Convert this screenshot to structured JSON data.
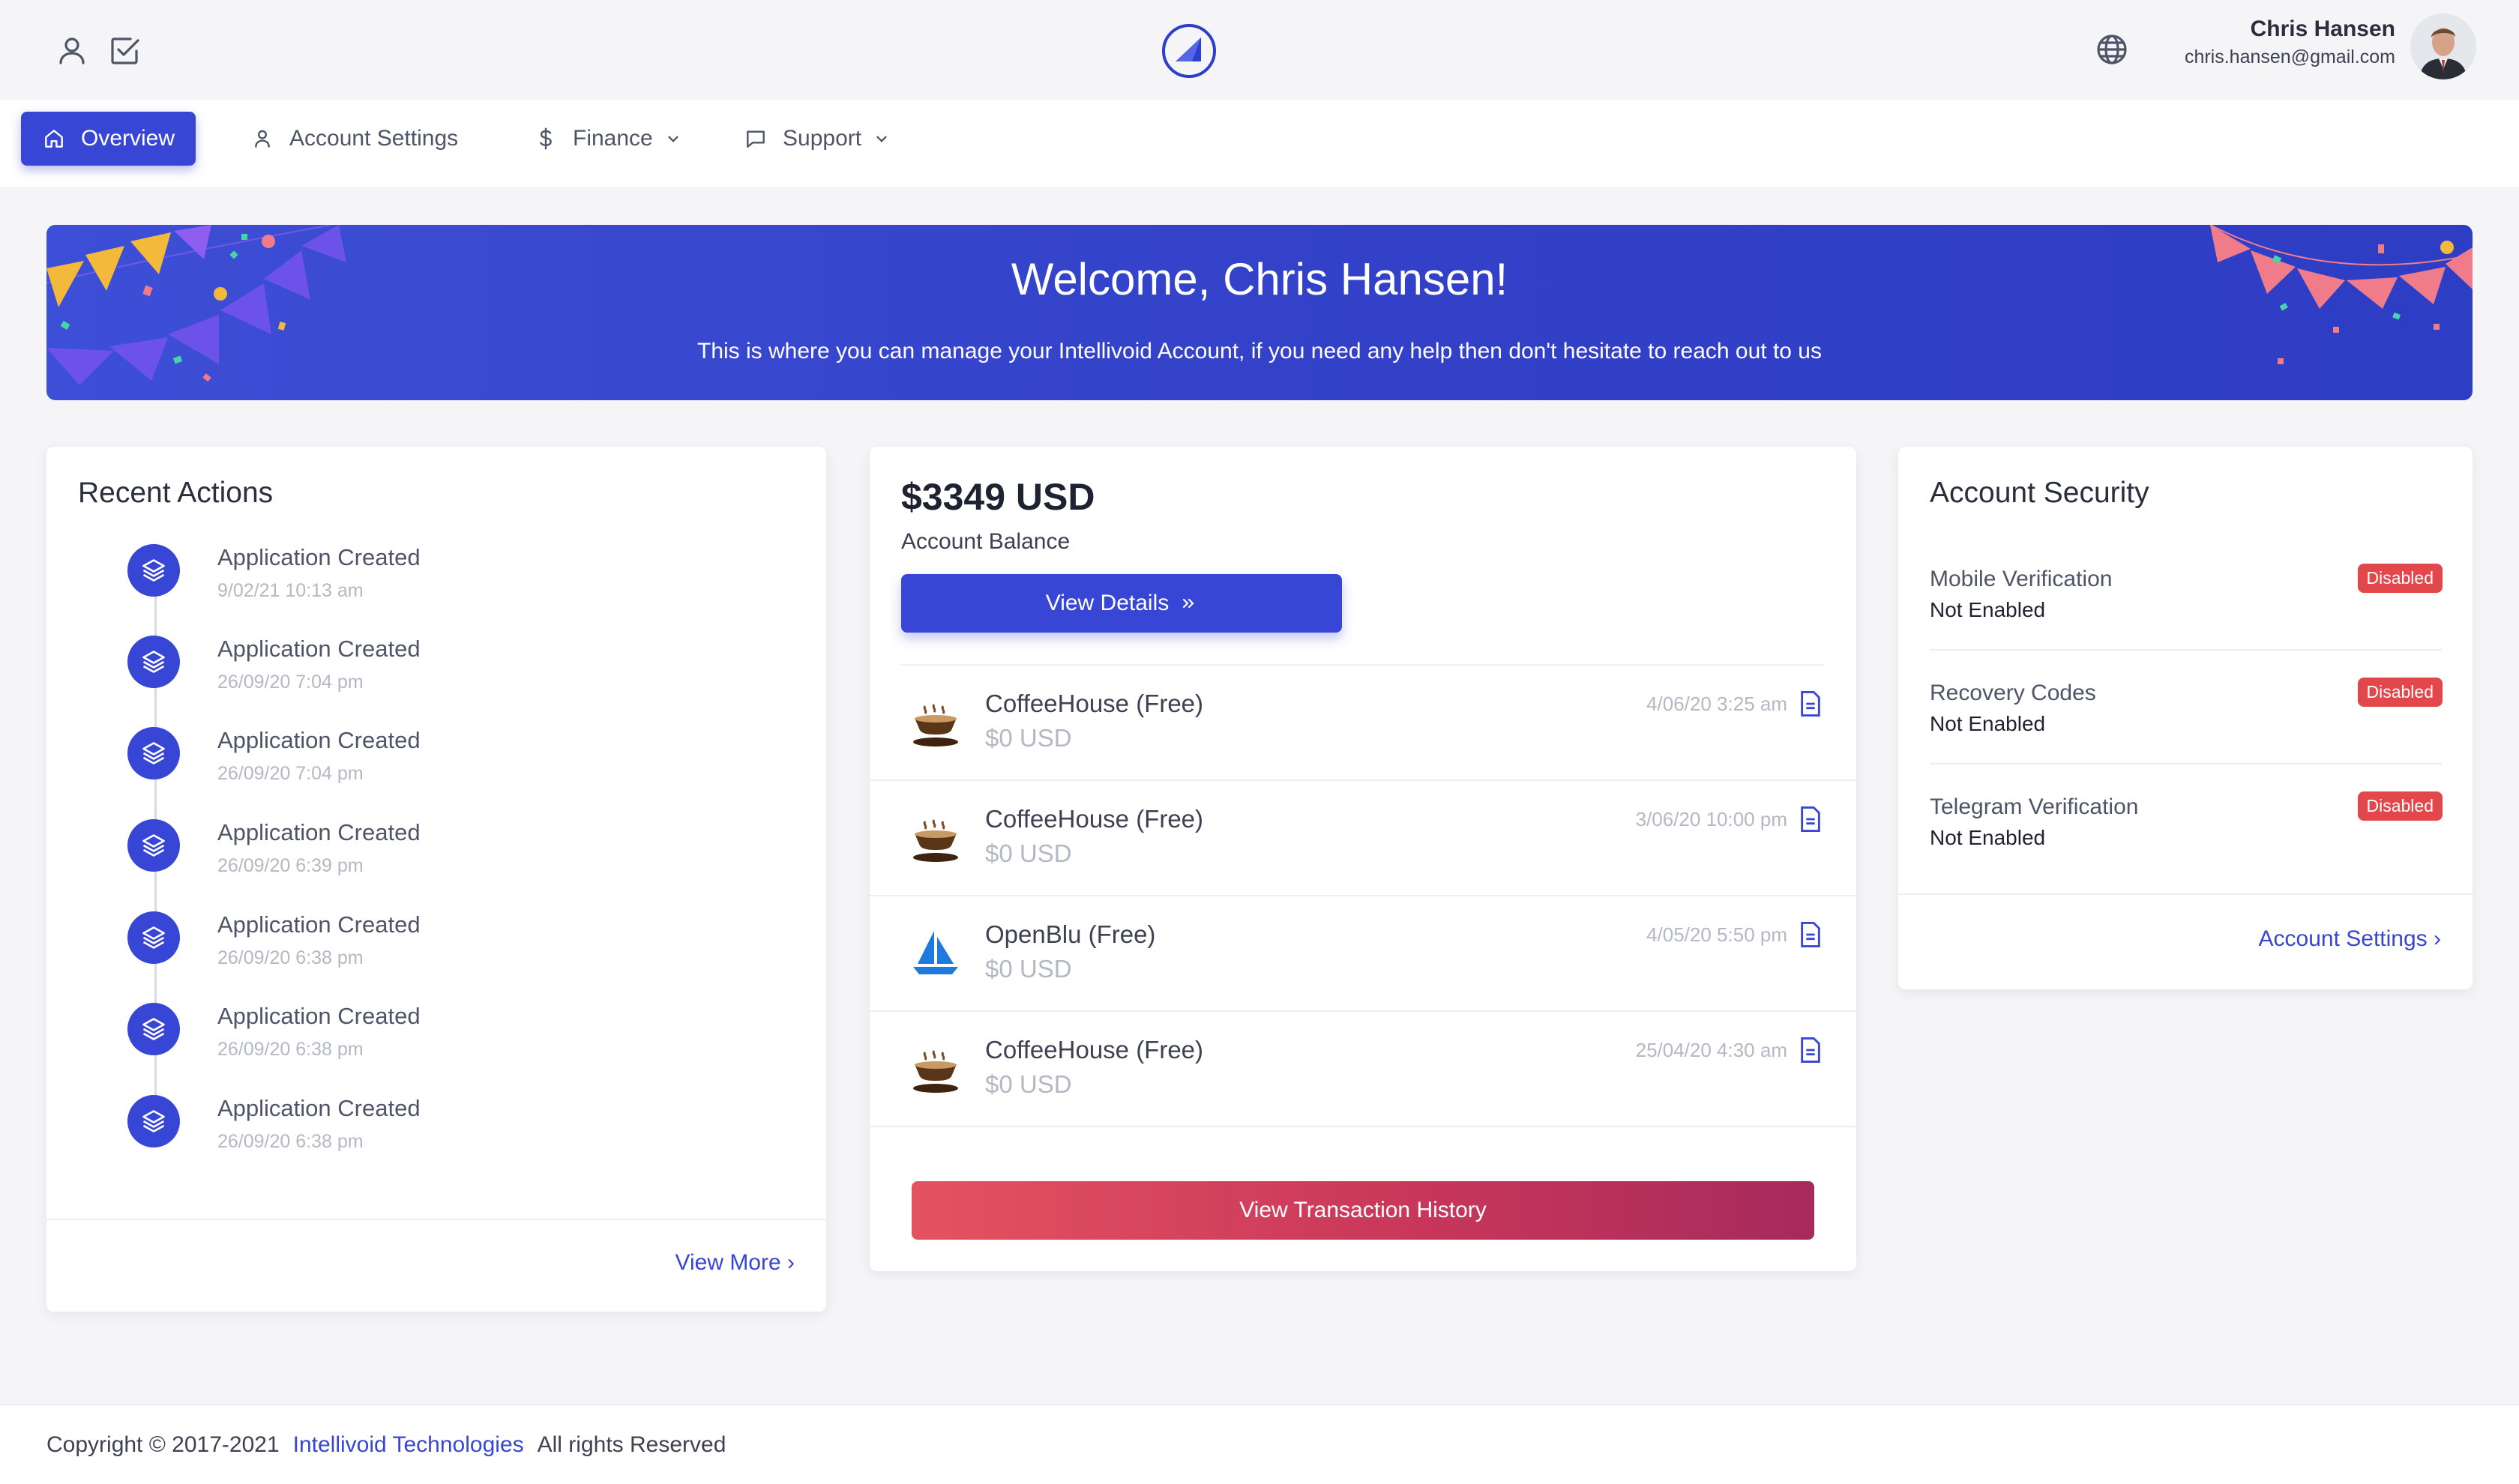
{
  "header": {
    "user_name": "Chris Hansen",
    "user_email": "chris.hansen@gmail.com"
  },
  "nav": {
    "items": [
      {
        "label": "Overview",
        "icon": "home-icon",
        "active": true
      },
      {
        "label": "Account Settings",
        "icon": "user-icon"
      },
      {
        "label": "Finance",
        "icon": "dollar-icon",
        "dropdown": true
      },
      {
        "label": "Support",
        "icon": "chat-icon",
        "dropdown": true
      }
    ]
  },
  "banner": {
    "title": "Welcome, Chris Hansen!",
    "subtitle": "This is where you can manage your Intellivoid Account, if you need any help then don't hesitate to reach out to us"
  },
  "recent_actions": {
    "title": "Recent Actions",
    "items": [
      {
        "title": "Application Created",
        "time": "9/02/21 10:13 am"
      },
      {
        "title": "Application Created",
        "time": "26/09/20 7:04 pm"
      },
      {
        "title": "Application Created",
        "time": "26/09/20 7:04 pm"
      },
      {
        "title": "Application Created",
        "time": "26/09/20 6:39 pm"
      },
      {
        "title": "Application Created",
        "time": "26/09/20 6:38 pm"
      },
      {
        "title": "Application Created",
        "time": "26/09/20 6:38 pm"
      },
      {
        "title": "Application Created",
        "time": "26/09/20 6:38 pm"
      }
    ],
    "view_more": "View More ›"
  },
  "balance": {
    "amount": "$3349 USD",
    "label": "Account Balance",
    "details_button": "View Details",
    "transactions": [
      {
        "name": "CoffeeHouse (Free)",
        "amount": "$0 USD",
        "date": "4/06/20 3:25 am",
        "icon": "coffee-cup-icon"
      },
      {
        "name": "CoffeeHouse (Free)",
        "amount": "$0 USD",
        "date": "3/06/20 10:00 pm",
        "icon": "coffee-cup-icon"
      },
      {
        "name": "OpenBlu (Free)",
        "amount": "$0 USD",
        "date": "4/05/20 5:50 pm",
        "icon": "sailboat-icon"
      },
      {
        "name": "CoffeeHouse (Free)",
        "amount": "$0 USD",
        "date": "25/04/20 4:30 am",
        "icon": "coffee-cup-icon"
      }
    ],
    "history_button": "View Transaction History"
  },
  "security": {
    "title": "Account Security",
    "items": [
      {
        "label": "Mobile Verification",
        "status": "Not Enabled",
        "badge": "Disabled"
      },
      {
        "label": "Recovery Codes",
        "status": "Not Enabled",
        "badge": "Disabled"
      },
      {
        "label": "Telegram Verification",
        "status": "Not Enabled",
        "badge": "Disabled"
      }
    ],
    "settings_link": "Account Settings ›"
  },
  "footer": {
    "copyright": "Copyright © 2017-2021",
    "company": "Intellivoid Technologies",
    "rights": "All rights Reserved"
  },
  "colors": {
    "primary": "#3746d4",
    "danger": "#e2474b",
    "background": "#f5f5f7"
  }
}
